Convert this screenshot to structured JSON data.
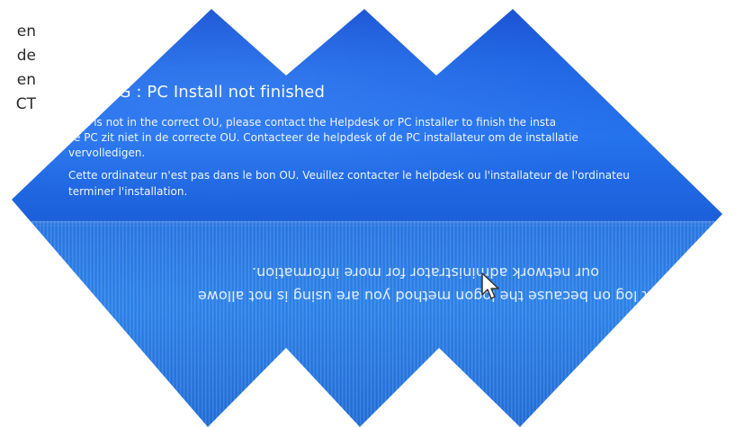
{
  "side_text": [
    "en",
    "de",
    "en",
    "CT"
  ],
  "dialog": {
    "title": "NG : PC Install not finished",
    "lines": [
      "C is not in the correct OU, please contact the Helpdesk or PC installer to finish the insta",
      "e PC zit niet in de correcte OU. Contacteer de helpdesk of de PC installateur om de installatie",
      "vervolledigen.",
      "Cette ordinateur n'est pas dans le bon OU. Veuillez contacter le helpdesk ou l'installateur de l'ordinateu",
      "terminer l'installation."
    ]
  },
  "reflection": {
    "line1": "our network administrator for more information.",
    "line2": "not log on because the logon method you are using is not allowe"
  },
  "cursor": {
    "icon": "mouse-pointer-icon"
  },
  "colors": {
    "screen_blue": "#1d63e2",
    "text": "#eef4ff"
  }
}
